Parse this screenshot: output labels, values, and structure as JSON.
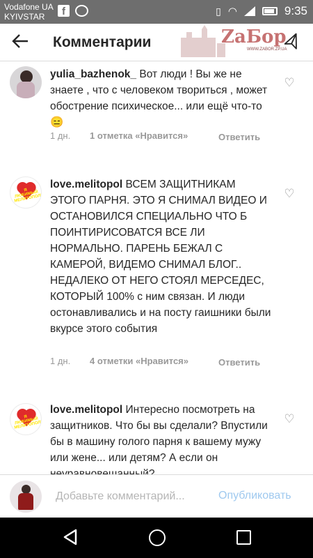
{
  "status_bar": {
    "carrier_line1": "Vodafone UA",
    "carrier_line2": "KYIVSTAR",
    "time": "9:35",
    "icons": [
      "facebook-icon",
      "messenger-icon",
      "vibrate-icon",
      "wifi-icon",
      "signal-icon",
      "battery-icon"
    ]
  },
  "header": {
    "title": "Комментарии",
    "back_icon": "arrow-left-icon",
    "send_icon": "send-icon",
    "watermark_text": "ZaБор",
    "watermark_sub": "WWW.ZABOR.ZP.UA"
  },
  "comments": [
    {
      "username": "yulia_bazhenok_",
      "text": " Вот люди ! Вы же не знаете , что с человеком твориться , может обострение психическое... или ещё что-то 😑",
      "time": "1 дн.",
      "likes": "1 отметка «Нравится»",
      "reply": "Ответить"
    },
    {
      "username": "love.melitopol",
      "text": " ВСЕМ ЗАЩИТНИКАМ ЭТОГО ПАРНЯ. ЭТО Я СНИМАЛ ВИДЕО И ОСТАНОВИЛСЯ СПЕЦИАЛЬНО ЧТО Б ПОИНТИРИСОВАТСЯ ВСЕ ЛИ НОРМАЛЬНО. ПАРЕНЬ БЕЖАЛ С КАМЕРОЙ, ВИДЕМО СНИМАЛ БЛОГ.. НЕДАЛЕКО ОТ НЕГО СТОЯЛ МЕРСЕДЕС, КОТОРЫЙ 100% с ним связан. И люди остонавливались и на посту гаишники были вкурсе этого события",
      "time": "1 дн.",
      "likes": "4 отметки «Нравится»",
      "reply": "Ответить",
      "avatar_text": "Я ЛЮБИМЫЙ МЕЛИТОПОЛЬ"
    },
    {
      "username": "love.melitopol",
      "text": " Интересно посмотреть на защитников. Что бы вы сделали? Впустили бы в машину голого парня к вашему мужу или жене... или детям? А если он неуравновешанный?",
      "avatar_text": "Я ЛЮБИМЫЙ МЕЛИТОПОЛЬ"
    }
  ],
  "input_bar": {
    "placeholder": "Добавьте комментарий...",
    "publish_label": "Опубликовать",
    "publish_color": "#9fc9ef"
  },
  "nav_bar": {
    "icons": [
      "nav-back-icon",
      "nav-home-icon",
      "nav-recents-icon"
    ]
  }
}
